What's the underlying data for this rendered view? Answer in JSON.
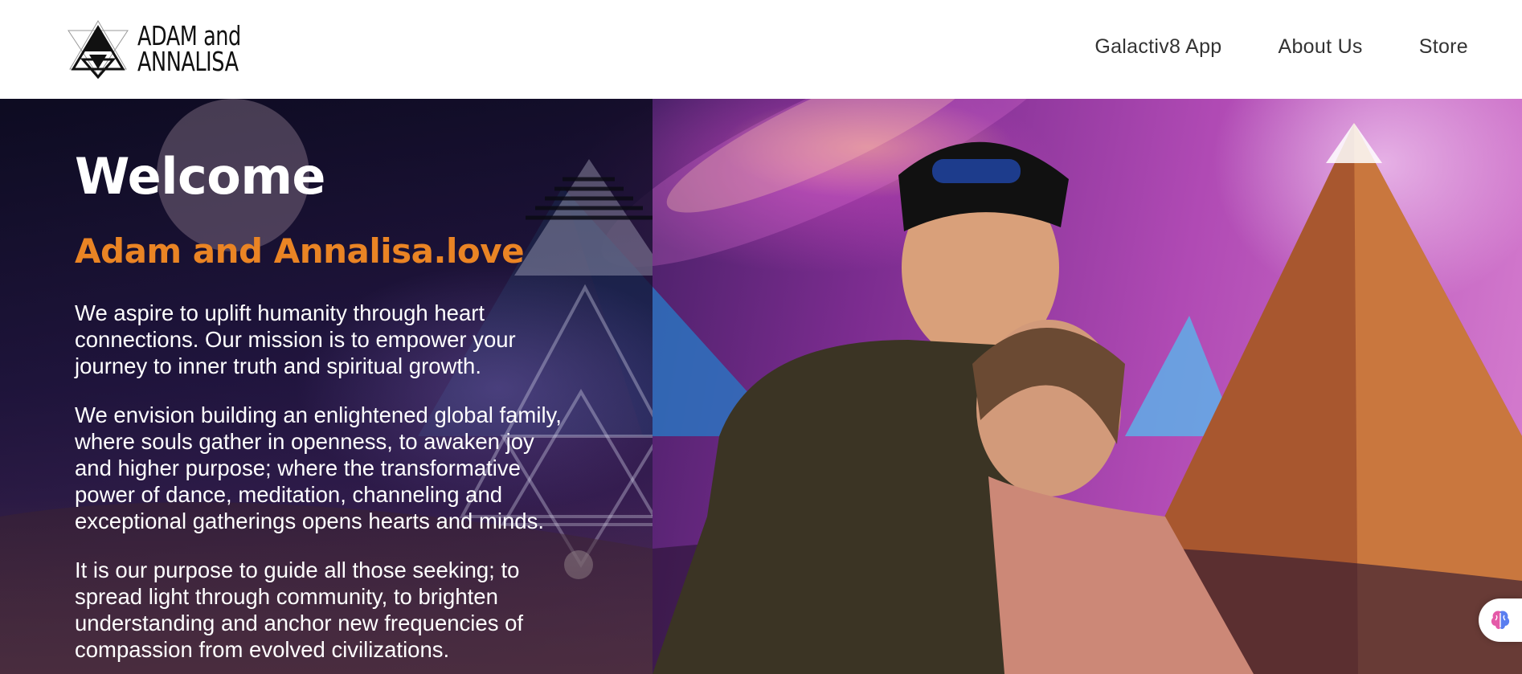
{
  "header": {
    "logo_line1": "ADAM and",
    "logo_line2": "ANNALISA",
    "nav": [
      {
        "label": "Galactiv8 App"
      },
      {
        "label": "About Us"
      },
      {
        "label": "Store"
      }
    ]
  },
  "hero": {
    "title": "Welcome",
    "subtitle": "Adam and Annalisa.love",
    "paragraphs": [
      "We aspire to uplift humanity through heart connections. Our mission is to empower your journey to inner truth and spiritual growth.",
      "We envision building an enlightened global family, where souls gather in openness, to awaken joy and higher purpose; where the transformative power of dance, meditation, channeling and exceptional gatherings opens hearts and minds.",
      "It is our purpose to guide all those seeking; to spread light through community, to brighten understanding and anchor new frequencies of compassion from evolved civilizations."
    ]
  },
  "colors": {
    "accent": "#ea8424",
    "nav_text": "#333333"
  },
  "icons": {
    "logo": "triangle-star-logo-icon",
    "fab": "brain-icon"
  }
}
